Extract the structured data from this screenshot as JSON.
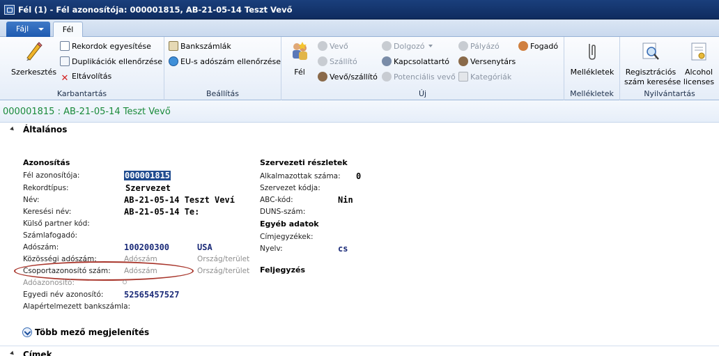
{
  "window": {
    "title": "Fél (1) - Fél azonosítója: 000001815, AB-21-05-14 Teszt Vevő"
  },
  "ribbon": {
    "file_tab": "Fájl",
    "active_tab": "Fél",
    "groups": {
      "karbantartas": {
        "label": "Karbantartás",
        "edit": "Szerkesztés",
        "merge": "Rekordok egyesítése",
        "dup": "Duplikációk ellenőrzése",
        "remove": "Eltávolítás"
      },
      "beallitasok": {
        "label": "Beállítás",
        "bank": "Bankszámlák",
        "eu": "EU-s adószám ellenőrzése"
      },
      "uj": {
        "label": "Új",
        "party": "Fél",
        "vevo": "Vevő",
        "szallito": "Szállító",
        "vevoszallito": "Vevő/szállító",
        "dolgozo": "Dolgozó",
        "kapcsolat": "Kapcsolattartó",
        "potencialis": "Potenciális vevő",
        "palyazo": "Pályázó",
        "versenytars": "Versenytárs",
        "kategoriak": "Kategóriák",
        "fogado": "Fogadó"
      },
      "mellekletek": {
        "label": "Mellékletek",
        "btn": "Mellékletek"
      },
      "nyilvantartas": {
        "label": "Nyilvántartás",
        "reg1": "Regisztrációs",
        "reg2": "szám keresése",
        "alc1": "Alcohol",
        "alc2": "licenses"
      }
    }
  },
  "record": {
    "title": "000001815 : AB-21-05-14 Teszt Vevő"
  },
  "section": {
    "title": "Általános"
  },
  "azonositas": {
    "heading": "Azonosítás",
    "fel_azon_label": "Fél azonosítója:",
    "fel_azon": "000001815",
    "rekordtipus_label": "Rekordtípus:",
    "rekordtipus": "Szervezet",
    "nev_label": "Név:",
    "nev": "AB-21-05-14 Teszt Veví",
    "kereses_label": "Keresési név:",
    "kereses": "AB-21-05-14 Te:",
    "kulso_label": "Külső partner kód:",
    "szamlafogado_label": "Számlafogadó:",
    "adoszam_label": "Adószám:",
    "adoszam": "100200300",
    "adoszam_orszag": "USA",
    "kozossegi_label": "Közösségi adószám:",
    "kozossegi_placeholder": "Adószám",
    "kozossegi_orszag": "Ország/terület",
    "csoport_label": "Csoportazonosító szám:",
    "csoport_placeholder": "Adószám",
    "csoport_orszag": "Ország/terület",
    "adoazon_label": "Adóazonosító:",
    "egyedi_label": "Egyedi név azonosító:",
    "egyedi": "52565457527",
    "bank_label": "Alapértelmezett bankszámla:"
  },
  "szervezeti": {
    "heading": "Szervezeti részletek",
    "alkalmazottak_label": "Alkalmazottak száma:",
    "alkalmazottak": "0",
    "kod_label": "Szervezet kódja:",
    "abc_label": "ABC-kód:",
    "abc": "Nin",
    "duns_label": "DUNS-szám:"
  },
  "egyeb": {
    "heading": "Egyéb adatok",
    "cimjegyzek_label": "Címjegyzékek:",
    "nyelv_label": "Nyelv:",
    "nyelv": "cs"
  },
  "feljegyzes": {
    "heading": "Feljegyzés"
  },
  "more_fields": "Több mező megjelenítés",
  "cimek": {
    "title": "Címek"
  }
}
